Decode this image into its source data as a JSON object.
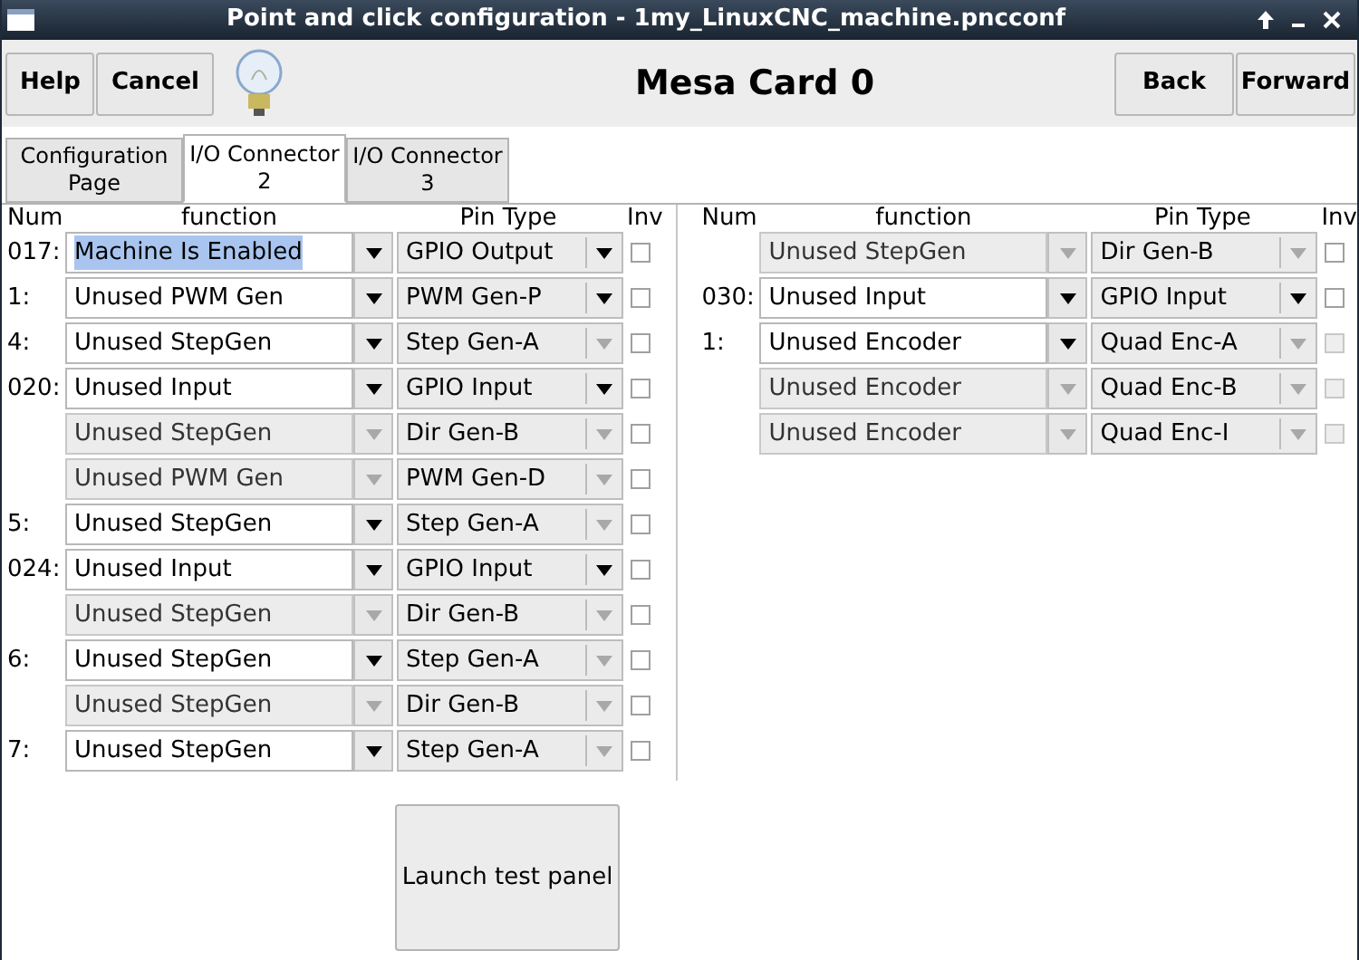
{
  "window": {
    "title": "Point and click configuration - 1my_LinuxCNC_machine.pncconf"
  },
  "header": {
    "left_buttons": [
      "Help",
      "Cancel"
    ],
    "heading": "Mesa Card 0",
    "right_buttons": [
      "Back",
      "Forward"
    ]
  },
  "tabs": [
    {
      "label": "Configuration Page",
      "selected": false
    },
    {
      "label": "I/O Connector 2",
      "selected": true
    },
    {
      "label": "I/O Connector 3",
      "selected": false
    }
  ],
  "panels": [
    {
      "columns": [
        "Num",
        "function",
        "Pin Type",
        "Inv"
      ],
      "rows": [
        {
          "num": "017:",
          "function": "Machine Is Enabled",
          "text_selected": true,
          "function_disabled": false,
          "pin_type": "GPIO Output",
          "pin_disabled": false,
          "inverted": false,
          "inv_disabled": false
        },
        {
          "num": "1:",
          "function": "Unused PWM Gen",
          "text_selected": false,
          "function_disabled": false,
          "pin_type": "PWM Gen-P",
          "pin_disabled": false,
          "inverted": false,
          "inv_disabled": false
        },
        {
          "num": "4:",
          "function": "Unused StepGen",
          "text_selected": false,
          "function_disabled": false,
          "pin_type": "Step Gen-A",
          "pin_disabled": true,
          "inverted": false,
          "inv_disabled": false
        },
        {
          "num": "020:",
          "function": "Unused Input",
          "text_selected": false,
          "function_disabled": false,
          "pin_type": "GPIO Input",
          "pin_disabled": false,
          "inverted": false,
          "inv_disabled": false
        },
        {
          "function": "Unused StepGen",
          "text_selected": false,
          "function_disabled": true,
          "pin_type": "Dir Gen-B",
          "pin_disabled": true,
          "inverted": false,
          "inv_disabled": false
        },
        {
          "function": "Unused PWM Gen",
          "text_selected": false,
          "function_disabled": true,
          "pin_type": "PWM Gen-D",
          "pin_disabled": true,
          "inverted": false,
          "inv_disabled": false
        },
        {
          "num": "5:",
          "function": "Unused StepGen",
          "text_selected": false,
          "function_disabled": false,
          "pin_type": "Step Gen-A",
          "pin_disabled": true,
          "inverted": false,
          "inv_disabled": false
        },
        {
          "num": "024:",
          "function": "Unused Input",
          "text_selected": false,
          "function_disabled": false,
          "pin_type": "GPIO Input",
          "pin_disabled": false,
          "inverted": false,
          "inv_disabled": false
        },
        {
          "function": "Unused StepGen",
          "text_selected": false,
          "function_disabled": true,
          "pin_type": "Dir Gen-B",
          "pin_disabled": true,
          "inverted": false,
          "inv_disabled": false
        },
        {
          "num": "6:",
          "function": "Unused StepGen",
          "text_selected": false,
          "function_disabled": false,
          "pin_type": "Step Gen-A",
          "pin_disabled": true,
          "inverted": false,
          "inv_disabled": false
        },
        {
          "function": "Unused StepGen",
          "text_selected": false,
          "function_disabled": true,
          "pin_type": "Dir Gen-B",
          "pin_disabled": true,
          "inverted": false,
          "inv_disabled": false
        },
        {
          "num": "7:",
          "function": "Unused StepGen",
          "text_selected": false,
          "function_disabled": false,
          "pin_type": "Step Gen-A",
          "pin_disabled": true,
          "inverted": false,
          "inv_disabled": false
        }
      ],
      "action_button": "Launch test panel"
    },
    {
      "columns": [
        "Num",
        "function",
        "Pin Type",
        "Inv"
      ],
      "rows": [
        {
          "function": "Unused StepGen",
          "text_selected": false,
          "function_disabled": true,
          "pin_type": "Dir Gen-B",
          "pin_disabled": true,
          "inverted": false,
          "inv_disabled": false
        },
        {
          "num": "030:",
          "function": "Unused Input",
          "text_selected": false,
          "function_disabled": false,
          "pin_type": "GPIO Input",
          "pin_disabled": false,
          "inverted": false,
          "inv_disabled": false
        },
        {
          "num": "1:",
          "function": "Unused Encoder",
          "text_selected": false,
          "function_disabled": false,
          "pin_type": "Quad Enc-A",
          "pin_disabled": true,
          "inverted": false,
          "inv_disabled": true
        },
        {
          "function": "Unused Encoder",
          "text_selected": false,
          "function_disabled": true,
          "pin_type": "Quad Enc-B",
          "pin_disabled": true,
          "inverted": false,
          "inv_disabled": true
        },
        {
          "function": "Unused Encoder",
          "text_selected": false,
          "function_disabled": true,
          "pin_type": "Quad Enc-I",
          "pin_disabled": true,
          "inverted": false,
          "inv_disabled": true
        }
      ]
    }
  ]
}
